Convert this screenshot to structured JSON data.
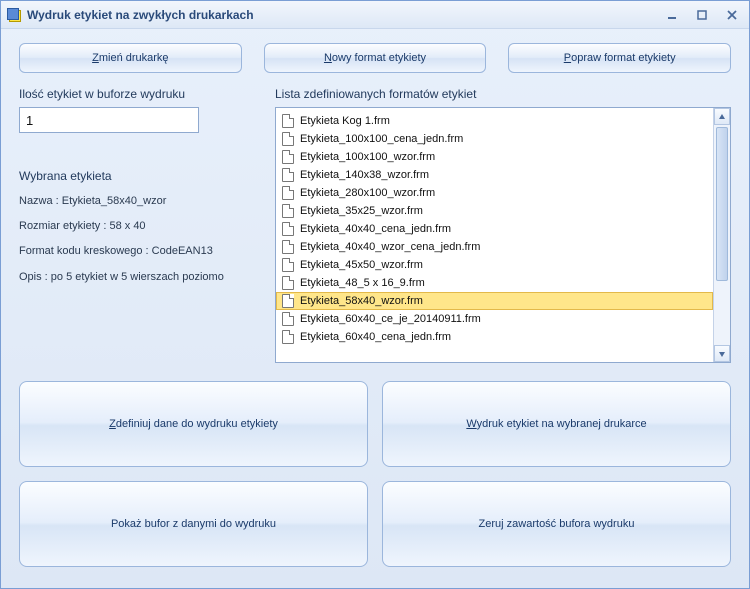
{
  "window": {
    "title": "Wydruk etykiet na zwykłych drukarkach"
  },
  "toolbar": {
    "change_printer": "Zmień drukarkę",
    "new_format": "Nowy format etykiety",
    "edit_format": "Popraw format etykiety"
  },
  "buffer": {
    "label": "Ilość etykiet w buforze wydruku",
    "value": "1"
  },
  "selected_label": {
    "heading": "Wybrana etykieta",
    "name_line": "Nazwa : Etykieta_58x40_wzor",
    "size_line": "Rozmiar etykiety : 58 x 40",
    "barcode_line": "Format kodu kreskowego : CodeEAN13",
    "desc_line": "Opis : po 5 etykiet w 5 wierszach poziomo"
  },
  "formats": {
    "label": "Lista zdefiniowanych formatów etykiet",
    "items": [
      {
        "name": "Etykieta Kog 1.frm",
        "selected": false
      },
      {
        "name": "Etykieta_100x100_cena_jedn.frm",
        "selected": false
      },
      {
        "name": "Etykieta_100x100_wzor.frm",
        "selected": false
      },
      {
        "name": "Etykieta_140x38_wzor.frm",
        "selected": false
      },
      {
        "name": "Etykieta_280x100_wzor.frm",
        "selected": false
      },
      {
        "name": "Etykieta_35x25_wzor.frm",
        "selected": false
      },
      {
        "name": "Etykieta_40x40_cena_jedn.frm",
        "selected": false
      },
      {
        "name": "Etykieta_40x40_wzor_cena_jedn.frm",
        "selected": false
      },
      {
        "name": "Etykieta_45x50_wzor.frm",
        "selected": false
      },
      {
        "name": "Etykieta_48_5 x 16_9.frm",
        "selected": false
      },
      {
        "name": "Etykieta_58x40_wzor.frm",
        "selected": true
      },
      {
        "name": "Etykieta_60x40_ce_je_20140911.frm",
        "selected": false
      },
      {
        "name": "Etykieta_60x40_cena_jedn.frm",
        "selected": false
      }
    ]
  },
  "actions": {
    "define_data": "Zdefiniuj dane do wydruku etykiety",
    "print_selected": "Wydruk etykiet na wybranej drukarce",
    "show_buffer": "Pokaż bufor z danymi do wydruku",
    "clear_buffer": "Zeruj zawartość bufora wydruku"
  }
}
